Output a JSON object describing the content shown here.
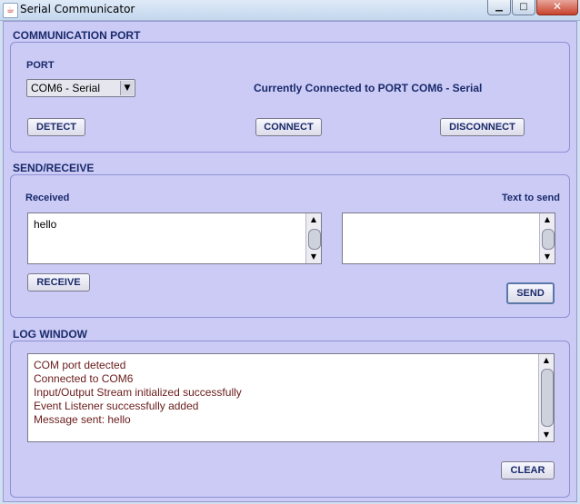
{
  "window": {
    "title": "Serial Communicator",
    "icon": "java-coffee-icon",
    "minimize": "▁",
    "maximize": "□",
    "close": "✕"
  },
  "comm_port": {
    "section_title": "COMMUNICATION PORT",
    "port_label": "PORT",
    "port_selected": "COM6 - Serial",
    "status": "Currently Connected to PORT COM6 - Serial",
    "detect_label": "DETECT",
    "connect_label": "CONNECT",
    "disconnect_label": "DISCONNECT"
  },
  "send_receive": {
    "section_title": "SEND/RECEIVE",
    "received_label": "Received",
    "received_text": "hello",
    "send_label": "Text to send",
    "send_text": "",
    "receive_button": "RECEIVE",
    "send_button": "SEND"
  },
  "log": {
    "section_title": "LOG WINDOW",
    "lines": [
      "COM port detected",
      "Connected to COM6",
      "Input/Output Stream initialized successfully",
      "Event Listener successfully added",
      "Message sent: hello"
    ],
    "clear_button": "CLEAR"
  }
}
